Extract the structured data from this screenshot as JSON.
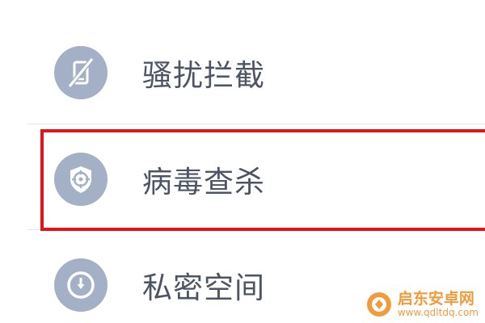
{
  "menu": {
    "items": [
      {
        "label": "骚扰拦截",
        "icon": "blocked-phone-icon"
      },
      {
        "label": "病毒查杀",
        "icon": "shield-target-icon"
      },
      {
        "label": "私密空间",
        "icon": "private-clock-icon"
      }
    ]
  },
  "highlight": {
    "color": "#e0141a"
  },
  "watermark": {
    "name": "启东安卓网",
    "url": "www.qdltdq.com"
  },
  "colors": {
    "icon_bg": "#a3b0c6",
    "label": "#4d5565",
    "watermark": "#f08a1c"
  }
}
